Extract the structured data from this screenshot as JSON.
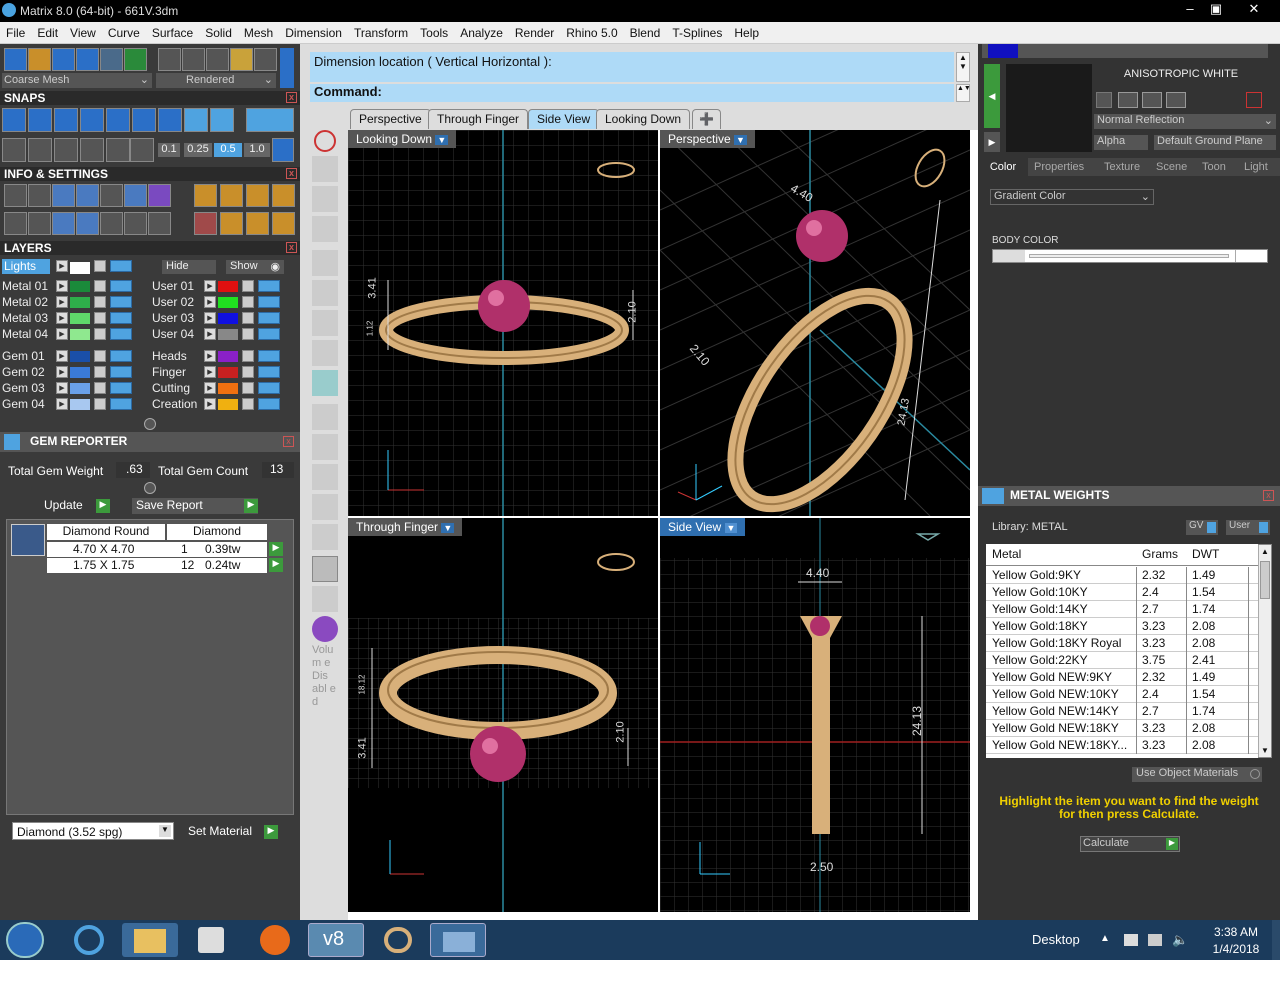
{
  "title": "Matrix 8.0 (64-bit) - 661V.3dm",
  "menu": [
    "File",
    "Edit",
    "View",
    "Curve",
    "Surface",
    "Solid",
    "Mesh",
    "Dimension",
    "Transform",
    "Tools",
    "Analyze",
    "Render",
    "Rhino 5.0",
    "Blend",
    "T-Splines",
    "Help"
  ],
  "toolbar": {
    "mesh_select": "Coarse Mesh",
    "render_select": "Rendered"
  },
  "snaps": {
    "title": "SNAPS",
    "values": [
      "0.1",
      "0.25",
      "0.5",
      "1.0"
    ]
  },
  "info": {
    "title": "INFO & SETTINGS"
  },
  "layers": {
    "title": "LAYERS",
    "lights": "Lights",
    "hide": "Hide",
    "show": "Show",
    "left": [
      {
        "name": "Metal 01",
        "color": "#1a8a3a"
      },
      {
        "name": "Metal 02",
        "color": "#2eae4a"
      },
      {
        "name": "Metal 03",
        "color": "#5fd86a"
      },
      {
        "name": "Metal 04",
        "color": "#8fe88f"
      },
      {
        "name": "Gem 01",
        "color": "#1a4fa8"
      },
      {
        "name": "Gem 02",
        "color": "#3a7ad8"
      },
      {
        "name": "Gem 03",
        "color": "#6aa0e8"
      },
      {
        "name": "Gem 04",
        "color": "#a8c8f0"
      }
    ],
    "right": [
      {
        "name": "User 01",
        "color": "#e01010"
      },
      {
        "name": "User 02",
        "color": "#20e020"
      },
      {
        "name": "User 03",
        "color": "#1010e0"
      },
      {
        "name": "User 04",
        "color": "#888888"
      },
      {
        "name": "Heads",
        "color": "#8a20c8"
      },
      {
        "name": "Finger",
        "color": "#c82020"
      },
      {
        "name": "Cutting",
        "color": "#f07010"
      },
      {
        "name": "Creation",
        "color": "#f0b010"
      }
    ]
  },
  "gem_reporter": {
    "title": "GEM REPORTER",
    "weight_label": "Total Gem Weight",
    "weight": ".63",
    "count_label": "Total Gem Count",
    "count": "13",
    "update": "Update",
    "save": "Save Report",
    "header": [
      "Diamond Round",
      "Diamond"
    ],
    "rows": [
      {
        "size": "4.70 X 4.70",
        "qty": "1",
        "ct": "0.39tw"
      },
      {
        "size": "1.75 X 1.75",
        "qty": "12",
        "ct": "0.24tw"
      }
    ],
    "material": "Diamond   (3.52 spg)",
    "set_material": "Set Material"
  },
  "command": {
    "prompt": "Dimension location ( Vertical  Horizontal ):",
    "label": "Command:"
  },
  "tabs": [
    "Perspective",
    "Through Finger",
    "Side View",
    "Looking Down"
  ],
  "viewports": {
    "tl": {
      "label": "Looking Down",
      "dims": [
        "3.41",
        "2.10",
        "1.12"
      ]
    },
    "tr": {
      "label": "Perspective",
      "dims": [
        "4.40",
        "2.10",
        "24.13"
      ]
    },
    "bl": {
      "label": "Through Finger",
      "dims": [
        "18.12",
        "3.41",
        "2.10"
      ]
    },
    "br": {
      "label": "Side View",
      "dims": [
        "4.40",
        "24.13",
        "2.50"
      ]
    }
  },
  "sidebar_text": "Volum e Dis abl ed",
  "right": {
    "material_name": "ANISOTROPIC WHITE",
    "reflection": "Normal Reflection",
    "alpha": "Alpha",
    "ground": "Default Ground Plane",
    "tabs": [
      "Color",
      "Properties",
      "Texture",
      "Scene",
      "Toon",
      "Light"
    ],
    "gradient": "Gradient Color",
    "body_color": "BODY COLOR"
  },
  "metal_weights": {
    "title": "METAL WEIGHTS",
    "library": "Library: METAL",
    "gv": "GV",
    "user": "User",
    "columns": [
      "Metal",
      "Grams",
      "DWT"
    ],
    "rows": [
      [
        "Yellow Gold:9KY",
        "2.32",
        "1.49"
      ],
      [
        "Yellow Gold:10KY",
        "2.4",
        "1.54"
      ],
      [
        "Yellow Gold:14KY",
        "2.7",
        "1.74"
      ],
      [
        "Yellow Gold:18KY",
        "3.23",
        "2.08"
      ],
      [
        "Yellow Gold:18KY Royal",
        "3.23",
        "2.08"
      ],
      [
        "Yellow Gold:22KY",
        "3.75",
        "2.41"
      ],
      [
        "Yellow Gold NEW:9KY",
        "2.32",
        "1.49"
      ],
      [
        "Yellow Gold NEW:10KY",
        "2.4",
        "1.54"
      ],
      [
        "Yellow Gold NEW:14KY",
        "2.7",
        "1.74"
      ],
      [
        "Yellow Gold NEW:18KY",
        "3.23",
        "2.08"
      ],
      [
        "Yellow Gold NEW:18KY...",
        "3.23",
        "2.08"
      ]
    ],
    "use_obj": "Use Object Materials",
    "hint": "Highlight the item you want to find the weight for then press Calculate.",
    "calculate": "Calculate"
  },
  "taskbar": {
    "desktop": "Desktop",
    "time": "3:38 AM",
    "date": "1/4/2018"
  }
}
